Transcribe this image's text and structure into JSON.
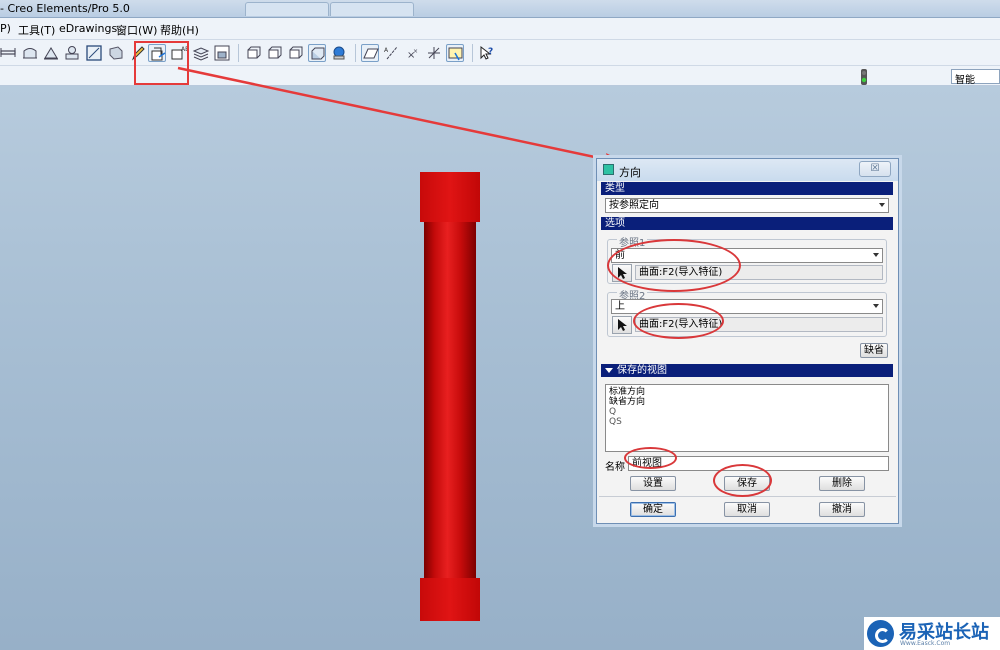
{
  "window": {
    "title": "- Creo Elements/Pro 5.0",
    "tabs": [
      "",
      ""
    ]
  },
  "menu": {
    "items": [
      "P)",
      "工具(T)",
      "eDrawings",
      "窗口(W)",
      "帮助(H)"
    ]
  },
  "toolbar": {
    "icons": [
      "dimension-icon",
      "datum-plane-icon",
      "datum-axis-icon",
      "datum-point-icon",
      "sketch-icon",
      "shaded-view-icon",
      "pencil-icon",
      "orient-icon",
      "named-view-icon",
      "layers-icon",
      "model-tree-icon",
      "refit-icon",
      "zoom-in-icon",
      "zoom-out-icon",
      "reorient-icon",
      "spin-center-icon",
      "datum-plane-display-icon",
      "axis-display-icon",
      "point-display-icon",
      "csys-display-icon",
      "repaint-icon",
      "whats-this-icon"
    ]
  },
  "status": {
    "filter_value": "智能"
  },
  "dialog": {
    "title": "方向",
    "close_label": "☒",
    "type_header": "类型",
    "type_value": "按参照定向",
    "options_header": "选项",
    "ref1": {
      "label": "参照1",
      "direction": "前",
      "reference": "曲面:F2(导入特征)"
    },
    "ref2": {
      "label": "参照2",
      "direction": "上",
      "reference": "曲面:F2(导入特征)"
    },
    "default_button": "缺省",
    "saved_views_header": "保存的视图",
    "saved_views": [
      "标准方向",
      "缺省方向",
      "Q",
      "QS"
    ],
    "name_label": "名称",
    "name_value": "前视图",
    "set_button": "设置",
    "save_button": "保存",
    "delete_button": "删除",
    "ok_button": "确定",
    "cancel_button": "取消",
    "undo_button": "撤消"
  },
  "watermark": {
    "text": "易采站长站",
    "sub": "Www.Easck.Com"
  },
  "colors": {
    "annotation": "#e53a3a",
    "model": "#d01010",
    "section_header": "#0a1f7a",
    "watermark": "#1b63b6"
  }
}
